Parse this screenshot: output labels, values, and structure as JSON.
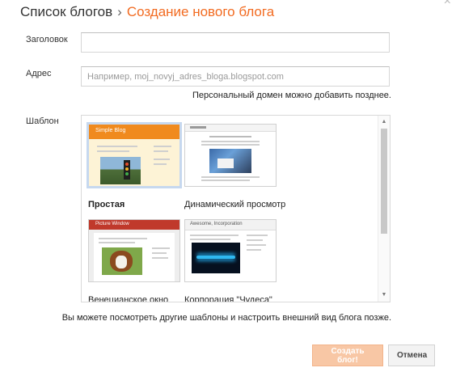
{
  "header": {
    "breadcrumb_parent": "Список блогов",
    "separator": "›",
    "current": "Создание нового блога"
  },
  "form": {
    "title_label": "Заголовок",
    "title_value": "",
    "address_label": "Адрес",
    "address_placeholder": "Например, moj_novyj_adres_bloga.blogspot.com",
    "address_hint": "Персональный домен можно добавить позднее.",
    "template_label": "Шаблон"
  },
  "templates": [
    {
      "name": "Простая",
      "selected": true,
      "thumb_title": "Simple Blog",
      "accent": "#f08a1e"
    },
    {
      "name": "Динамический просмотр",
      "selected": false
    },
    {
      "name": "Венецианское окно",
      "selected": false,
      "thumb_title": "Picture Window",
      "accent": "#c0392b"
    },
    {
      "name": "Корпорация \"Чудеса\"",
      "selected": false,
      "thumb_title": "Awesome, Incorporation"
    }
  ],
  "footer": {
    "note": "Вы можете посмотреть другие шаблоны и настроить внешний вид блога позже.",
    "create_button": "Создать блог!",
    "cancel_button": "Отмена"
  },
  "icons": {
    "close": "close-icon",
    "scroll_up": "scroll-up-arrow",
    "scroll_down": "scroll-down-arrow"
  },
  "colors": {
    "accent": "#f26b21",
    "create_button_bg": "#f8c7a5",
    "selected_border": "#c6d8ef"
  }
}
